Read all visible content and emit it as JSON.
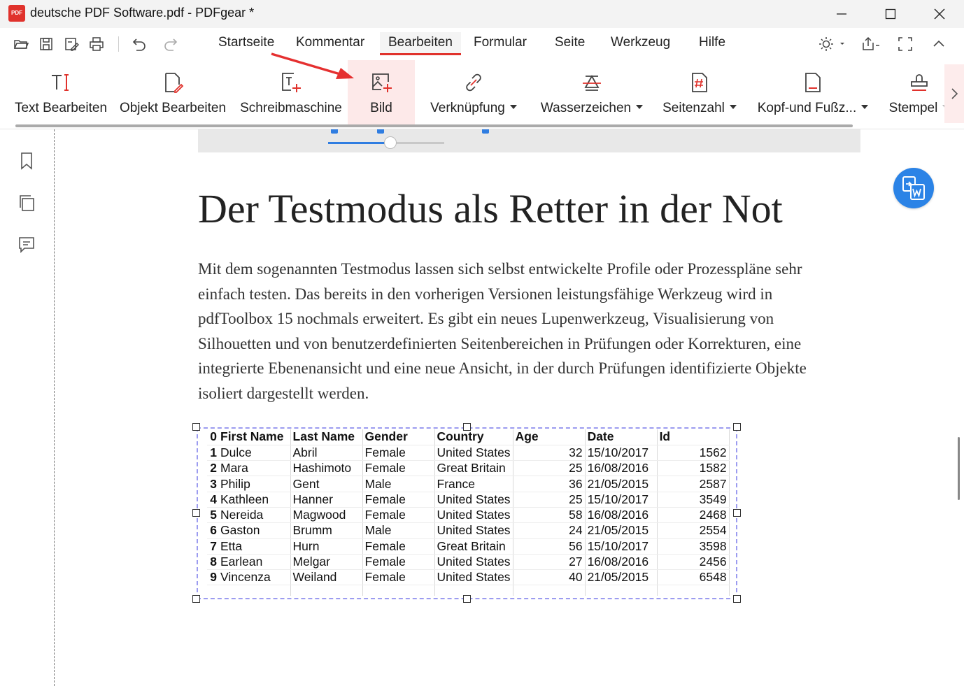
{
  "window": {
    "logo_text": "PDF",
    "title": "deutsche PDF Software.pdf - PDFgear *"
  },
  "menu": {
    "tabs": [
      {
        "label": "Startseite",
        "active": false
      },
      {
        "label": "Kommentar",
        "active": false
      },
      {
        "label": "Bearbeiten",
        "active": true
      },
      {
        "label": "Formular",
        "active": false
      },
      {
        "label": "Seite",
        "active": false
      },
      {
        "label": "Werkzeug",
        "active": false
      },
      {
        "label": "Hilfe",
        "active": false
      }
    ]
  },
  "ribbon": {
    "tools": [
      {
        "label": "Text Bearbeiten",
        "icon": "text-edit-icon",
        "dropdown": false
      },
      {
        "label": "Objekt Bearbeiten",
        "icon": "object-edit-icon",
        "dropdown": false
      },
      {
        "label": "Schreibmaschine",
        "icon": "typewriter-icon",
        "dropdown": false
      },
      {
        "label": "Bild",
        "icon": "image-add-icon",
        "dropdown": false,
        "highlighted": true
      },
      {
        "label": "Verknüpfung",
        "icon": "link-icon",
        "dropdown": true
      },
      {
        "label": "Wasserzeichen",
        "icon": "watermark-icon",
        "dropdown": true
      },
      {
        "label": "Seitenzahl",
        "icon": "page-number-icon",
        "dropdown": true
      },
      {
        "label": "Kopf-und Fußz...",
        "icon": "header-footer-icon",
        "dropdown": true
      },
      {
        "label": "Stempel",
        "icon": "stamp-icon",
        "dropdown": true
      }
    ]
  },
  "document": {
    "heading": "Der Testmodus als Retter in der Not",
    "paragraph": "Mit dem sogenannten Testmodus lassen sich selbst entwickelte Profile oder Prozesspläne sehr einfach testen. Das bereits in den vorherigen Versionen leistungsfähige Werkzeug wird in pdfToolbox 15 nochmals erweitert. Es gibt ein neues Lupenwerkzeug, Visualisierung von Silhouetten und von benutzerdefinierten Seitenbereichen in Prüfungen oder Korrekturen, eine integrierte Ebenenansicht und eine neue Ansicht, in der durch Prüfungen identifizierte Objekte isoliert dargestellt werden.",
    "table": {
      "headers": [
        "0",
        "First Name",
        "Last Name",
        "Gender",
        "Country",
        "Age",
        "Date",
        "Id"
      ],
      "rows": [
        [
          "1",
          "Dulce",
          "Abril",
          "Female",
          "United States",
          "32",
          "15/10/2017",
          "1562"
        ],
        [
          "2",
          "Mara",
          "Hashimoto",
          "Female",
          "Great Britain",
          "25",
          "16/08/2016",
          "1582"
        ],
        [
          "3",
          "Philip",
          "Gent",
          "Male",
          "France",
          "36",
          "21/05/2015",
          "2587"
        ],
        [
          "4",
          "Kathleen",
          "Hanner",
          "Female",
          "United States",
          "25",
          "15/10/2017",
          "3549"
        ],
        [
          "5",
          "Nereida",
          "Magwood",
          "Female",
          "United States",
          "58",
          "16/08/2016",
          "2468"
        ],
        [
          "6",
          "Gaston",
          "Brumm",
          "Male",
          "United States",
          "24",
          "21/05/2015",
          "2554"
        ],
        [
          "7",
          "Etta",
          "Hurn",
          "Female",
          "Great Britain",
          "56",
          "15/10/2017",
          "3598"
        ],
        [
          "8",
          "Earlean",
          "Melgar",
          "Female",
          "United States",
          "27",
          "16/08/2016",
          "2456"
        ],
        [
          "9",
          "Vincenza",
          "Weiland",
          "Female",
          "United States",
          "40",
          "21/05/2015",
          "6548"
        ]
      ]
    }
  },
  "colors": {
    "accent": "#e0322c",
    "convert_button": "#2b83e6",
    "selection": "#9c9cf0"
  }
}
